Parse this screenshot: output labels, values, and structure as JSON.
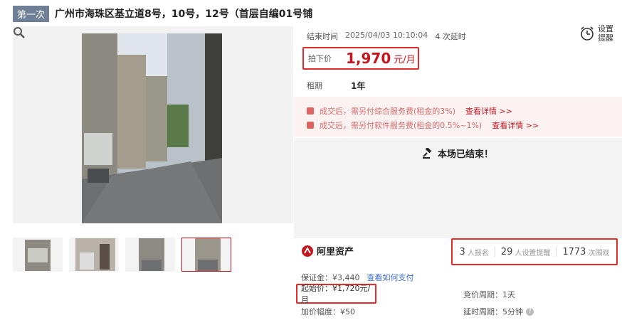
{
  "header": {
    "round_badge": "第一次",
    "title": "广州市海珠区基立道8号，10号，12号（首层自编01号铺"
  },
  "auction": {
    "end_label": "结束时间",
    "end_time": "2025/04/03 10:10:04",
    "delay_count": "4 次延时",
    "remind_label": "设置提醒",
    "price_label": "拍下价",
    "price_value": "1,970",
    "price_unit": "元/月",
    "term_label": "租期",
    "term_value": "1年"
  },
  "notices": [
    {
      "text": "成交后，需另付综合服务费(租金的3%)",
      "link": "查看详情 >>"
    },
    {
      "text": "成交后，需另付软件服务费(租金的0.5%~1%)",
      "link": "查看详情 >>"
    }
  ],
  "status": {
    "ended_text": "本场已结束！"
  },
  "platform": {
    "name": "阿里资产"
  },
  "stats": [
    {
      "count": "3",
      "label": "人报名"
    },
    {
      "count": "29",
      "label": "人设置提醒"
    },
    {
      "count": "1773",
      "label": "次围观"
    }
  ],
  "terms": {
    "deposit": "保证金：¥3,440",
    "deposit_link": "查看如何支付",
    "start_price": "起始价：¥1,720元/月",
    "bid_increment": "加价幅度：¥50",
    "bid_cycle": "竞价周期：1天",
    "delay_cycle": "延时周期：5分钟"
  },
  "colors": {
    "accent": "#c4161c",
    "highlight_border": "#e52a2a",
    "badge": "#6f7f95"
  },
  "icons": [
    "alarm-clock-icon",
    "gavel-icon",
    "zoom-icon",
    "ali-asset-logo-icon",
    "question-icon",
    "notice-icon"
  ]
}
